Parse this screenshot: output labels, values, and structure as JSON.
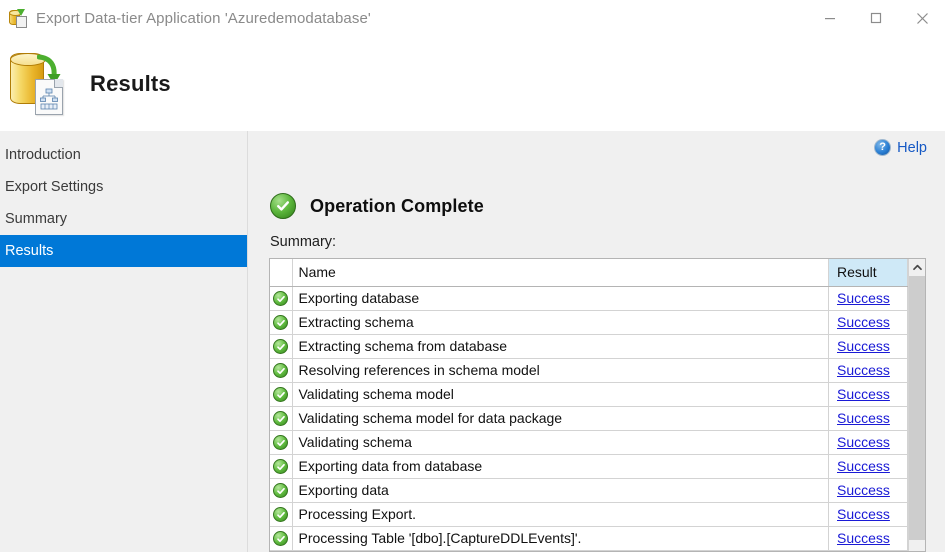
{
  "window": {
    "title": "Export Data-tier Application 'Azuredemodatabase'",
    "icon": "database-export-icon",
    "controls": {
      "minimize": "minimize-button",
      "maximize": "maximize-button",
      "close": "close-button"
    }
  },
  "header": {
    "title": "Results",
    "icon": "database-to-document-icon"
  },
  "sidebar": {
    "items": [
      {
        "label": "Introduction",
        "selected": false
      },
      {
        "label": "Export Settings",
        "selected": false
      },
      {
        "label": "Summary",
        "selected": false
      },
      {
        "label": "Results",
        "selected": true
      }
    ]
  },
  "content": {
    "help": {
      "label": "Help",
      "icon": "question-mark-icon"
    },
    "status": {
      "icon": "green-check-circle-icon",
      "text": "Operation Complete"
    },
    "summary_label": "Summary:",
    "table": {
      "columns": [
        "",
        "Name",
        "Result"
      ],
      "rows": [
        {
          "status": "success",
          "name": "Exporting database",
          "result": "Success"
        },
        {
          "status": "success",
          "name": "Extracting schema",
          "result": "Success"
        },
        {
          "status": "success",
          "name": "Extracting schema from database",
          "result": "Success"
        },
        {
          "status": "success",
          "name": "Resolving references in schema model",
          "result": "Success"
        },
        {
          "status": "success",
          "name": "Validating schema model",
          "result": "Success"
        },
        {
          "status": "success",
          "name": "Validating schema model for data package",
          "result": "Success"
        },
        {
          "status": "success",
          "name": "Validating schema",
          "result": "Success"
        },
        {
          "status": "success",
          "name": "Exporting data from database",
          "result": "Success"
        },
        {
          "status": "success",
          "name": "Exporting data",
          "result": "Success"
        },
        {
          "status": "success",
          "name": "Processing Export.",
          "result": "Success"
        },
        {
          "status": "success",
          "name": "Processing Table '[dbo].[CaptureDDLEvents]'.",
          "result": "Success"
        }
      ]
    },
    "scrollbar": {
      "up_arrow": "scroll-up-arrow-icon"
    }
  },
  "colors": {
    "accent_selected": "#0078d7",
    "link": "#1a1ad6",
    "help_link": "#1659c4",
    "success_green": "#5cb63c",
    "header_highlight": "#cfe9f7",
    "sidebar_bg": "#f0f0f0"
  }
}
